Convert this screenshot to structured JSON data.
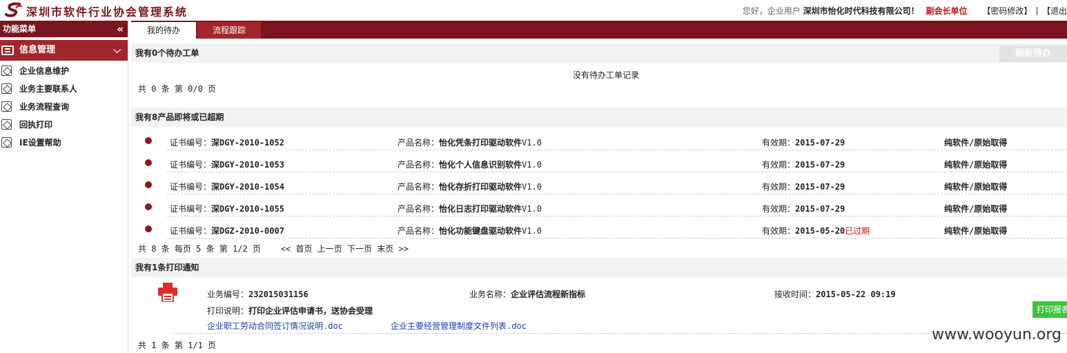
{
  "header": {
    "title": "深圳市软件行业协会管理系统",
    "greeting": "您好，企业用户",
    "company": "深圳市怡化时代科技有限公司！",
    "role": "副会长单位",
    "change_password": "【密码修改】",
    "logout": "【退出"
  },
  "sidebar": {
    "head": "功能菜单",
    "collapse": "«",
    "group": "信息管理",
    "items": [
      {
        "label": "企业信息维护"
      },
      {
        "label": "业务主要联系人"
      },
      {
        "label": "业务流程查询"
      },
      {
        "label": "回执打印"
      },
      {
        "label": "IE设置帮助"
      }
    ]
  },
  "tabs": [
    {
      "label": "我的待办"
    },
    {
      "label": "流程跟踪"
    }
  ],
  "todo": {
    "title": "我有0个待办工单",
    "refresh": "刷新待办",
    "empty": "没有待办工单记录",
    "pager": "共 0 条 第 0/0 页"
  },
  "products": {
    "title": "我有8产品即将或已超期",
    "cert_label": "证书编号：",
    "name_label": "产品名称：",
    "valid_label": "有效期：",
    "rows": [
      {
        "cert": "深DGY-2010-1052",
        "name": "怡化凭条打印驱动软件",
        "version": "V1.0",
        "valid": "2015-07-29",
        "expired": "",
        "status": "纯软件/原始取得"
      },
      {
        "cert": "深DGY-2010-1053",
        "name": "怡化个人信息识别软件",
        "version": "V1.0",
        "valid": "2015-07-29",
        "expired": "",
        "status": "纯软件/原始取得"
      },
      {
        "cert": "深DGY-2010-1054",
        "name": "怡化存折打印驱动软件",
        "version": "V1.0",
        "valid": "2015-07-29",
        "expired": "",
        "status": "纯软件/原始取得"
      },
      {
        "cert": "深DGY-2010-1055",
        "name": "怡化日志打印驱动软件",
        "version": "V1.0",
        "valid": "2015-07-29",
        "expired": "",
        "status": "纯软件/原始取得"
      },
      {
        "cert": "深DGZ-2010-0007",
        "name": "怡化功能键盘驱动软件",
        "version": "V1.0",
        "valid": "2015-05-20",
        "expired": "已过期",
        "status": "纯软件/原始取得"
      }
    ],
    "pager_info": "共 8 条 每页 5 条 第 1/2 页",
    "pager_links": [
      "<< 首页",
      "上一页",
      "下一页",
      "末页 >>"
    ]
  },
  "print_notice": {
    "title": "我有1条打印通知",
    "biz_no_label": "业务编号：",
    "biz_no": "232015031156",
    "biz_name_label": "业务名称：",
    "biz_name": "企业评估流程新指标",
    "recv_label": "接收时间：",
    "recv_time": "2015-05-22 09:19",
    "desc_label": "打印说明：",
    "desc": "打印企业评估申请书，送协会受理",
    "docs": [
      "企业职工劳动合同签订情况说明.doc",
      "企业主要经营管理制度文件列表.doc"
    ],
    "print_button": "打印报表",
    "pager": "共 1 条 第 1/1 页"
  },
  "watermark": "www.wooyun.org",
  "colors": {
    "brand": "#7a1520",
    "accent": "#a2262c",
    "alert": "#c0151b",
    "print_green": "#3cc53c"
  }
}
